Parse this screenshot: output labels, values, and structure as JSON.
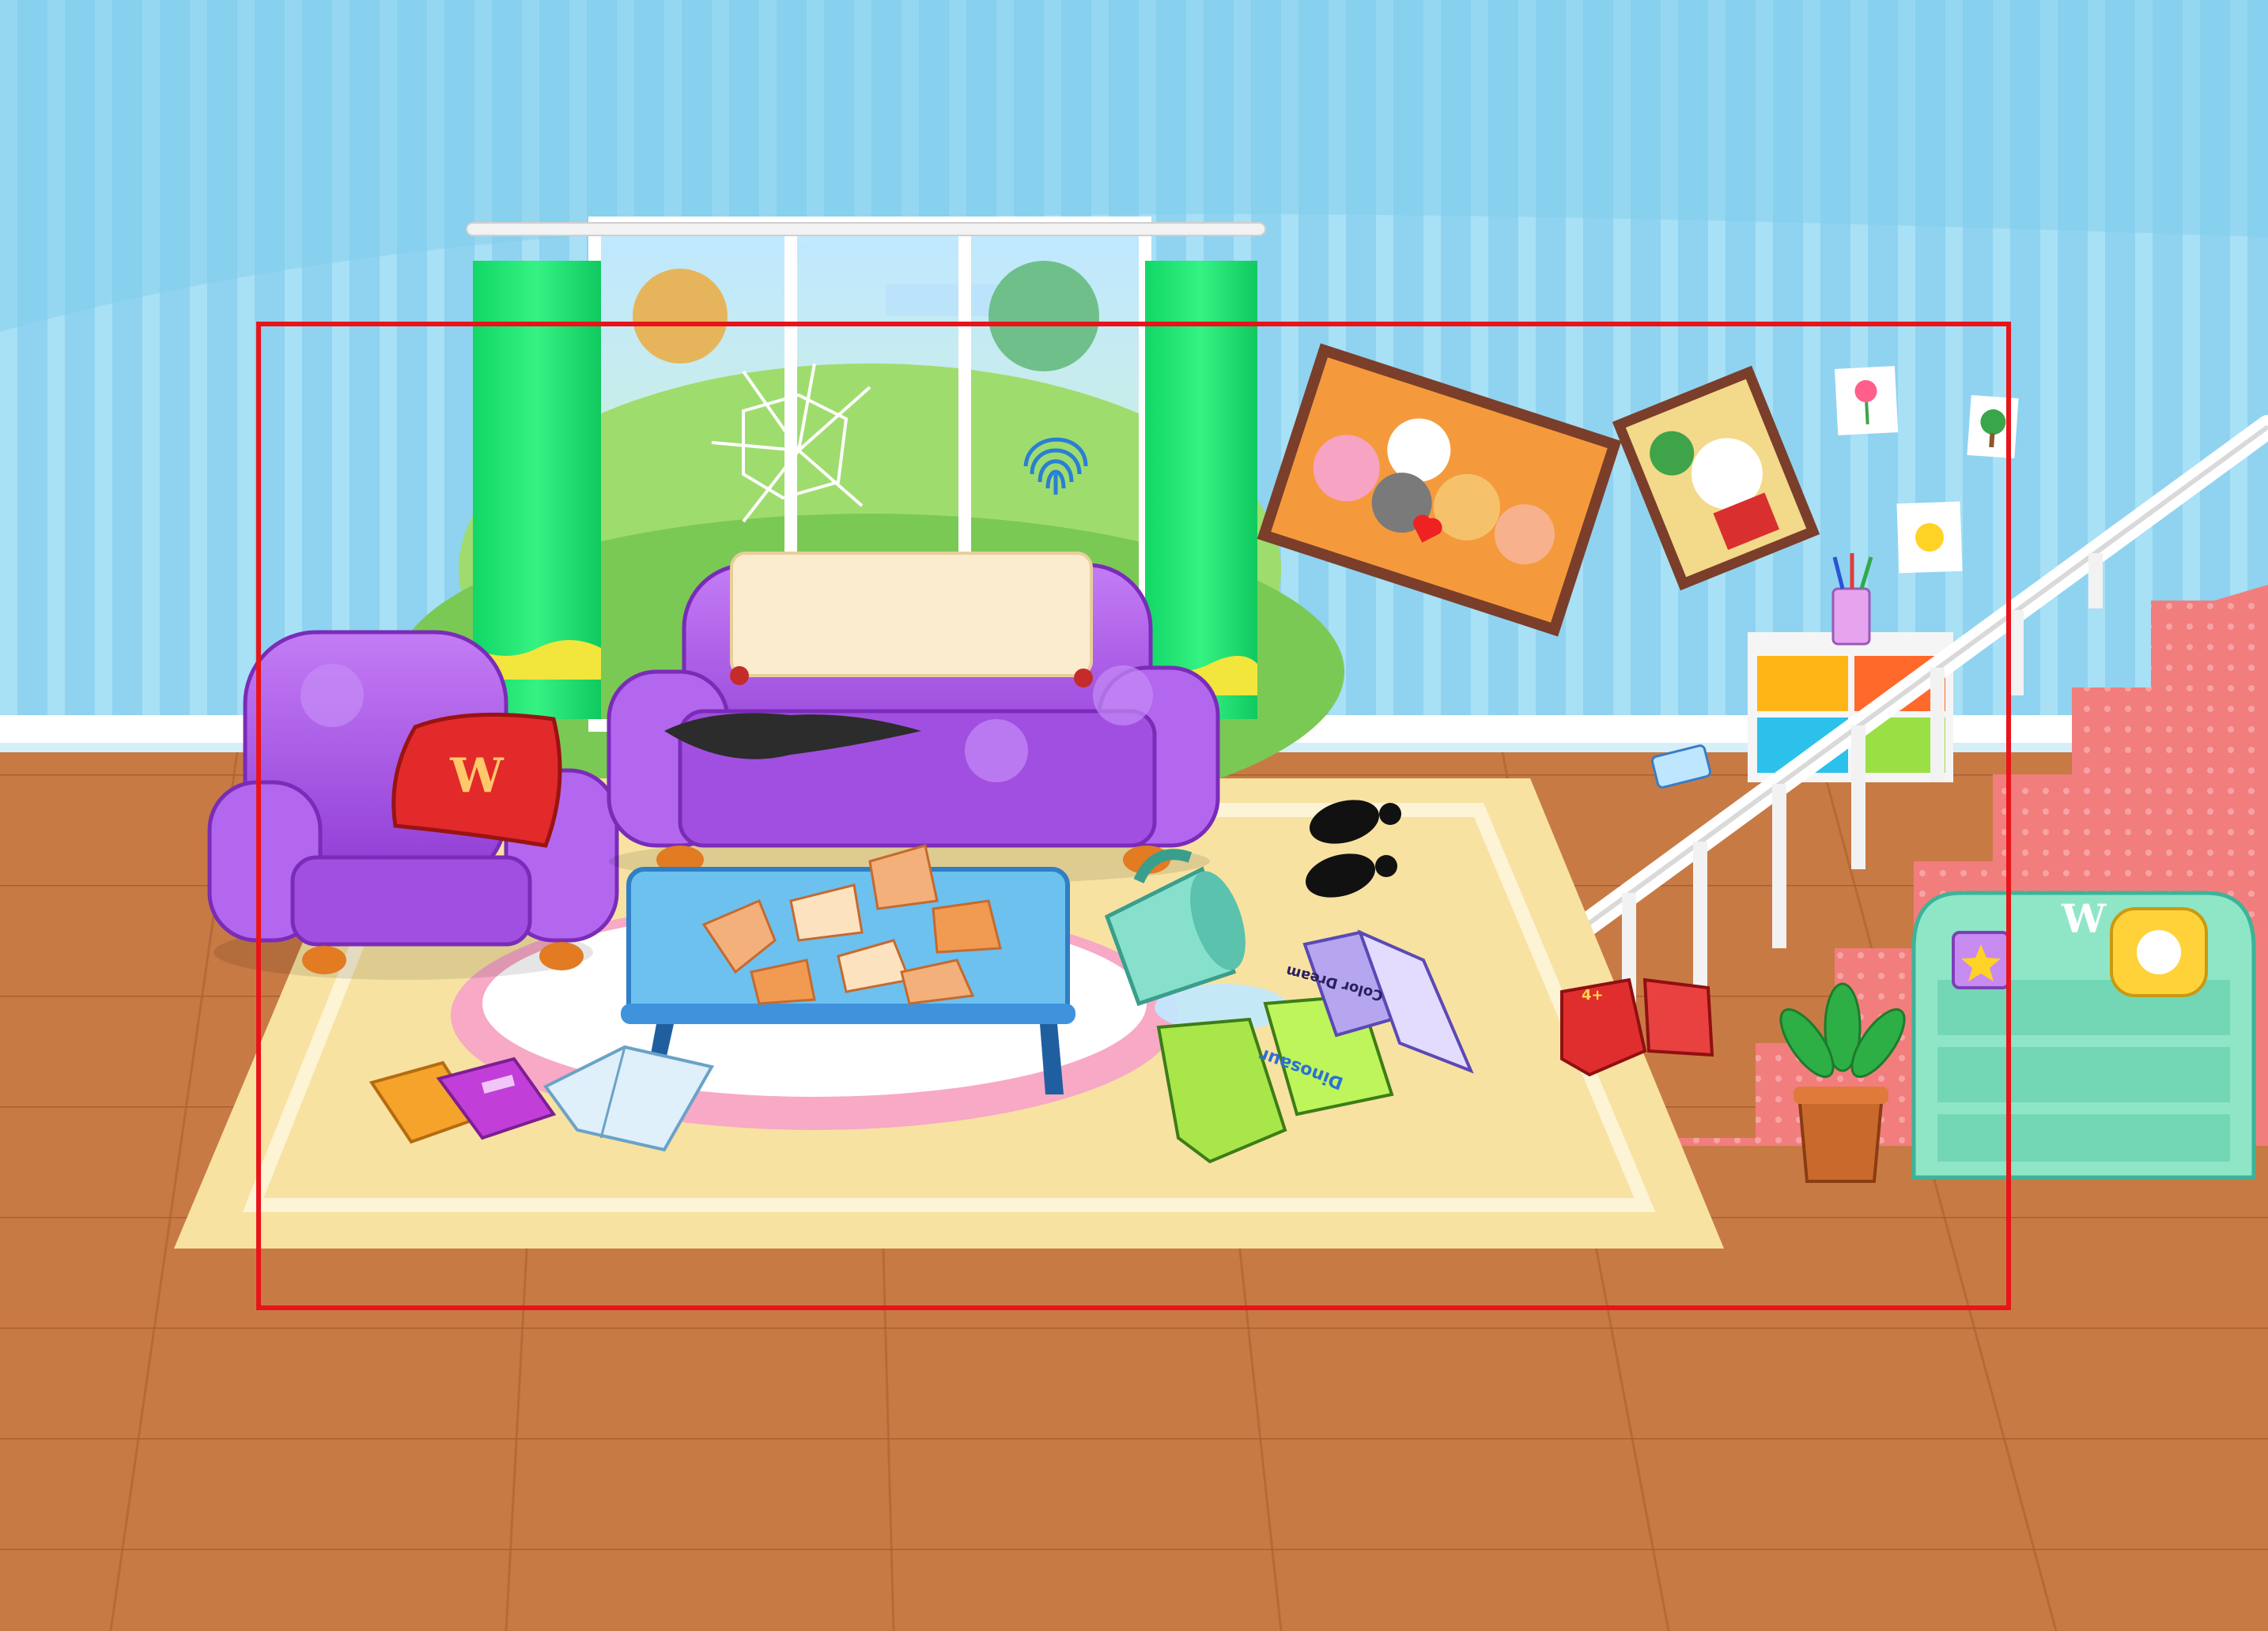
{
  "scene": {
    "name": "messy-living-room",
    "highlight_color": "#e8141a"
  },
  "colors": {
    "wall": "#8ed4f0",
    "wall_stripe": "#a6def5",
    "floor": "#c6763f",
    "rug": "#f7e2a0",
    "sofa": "#a34ee6",
    "curtain": "#19e36f",
    "shelf": "#8fe6c6",
    "stairs": "#f27b7b"
  },
  "books": {
    "dinosaur_title": "Dinosaur",
    "space_title": "Color Dream",
    "red_book_title": "4+"
  },
  "icons": {
    "fingerprint": "fingerprint-icon",
    "brand": "w-logo-icon"
  }
}
